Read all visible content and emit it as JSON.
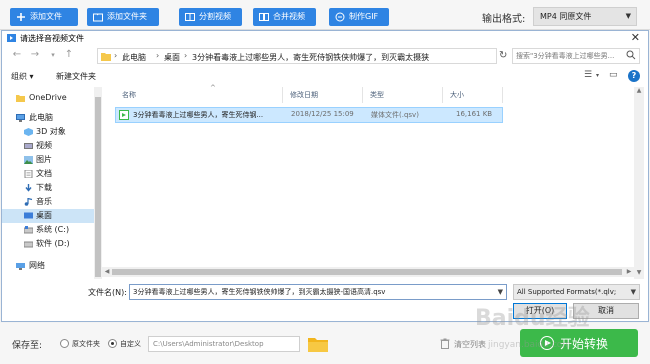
{
  "toolbar": {
    "add_file": "添加文件",
    "add_folder": "添加文件夹",
    "split_video": "分割视频",
    "merge_video": "合并视频",
    "make_gif": "制作GIF",
    "output_format_label": "输出格式:",
    "output_format_value": "MP4  同原文件",
    "accent": "#2f84e3"
  },
  "dialog": {
    "title": "请选择音视频文件",
    "breadcrumb": [
      "此电脑",
      "桌面",
      "3分钟看毒液上过哪些男人，寄生死侍钢铁侠帅爆了，到灭霸太摄狭"
    ],
    "search_placeholder": "搜索\"3分钟看毒液上过哪些男...",
    "organize": "组织 ▾",
    "new_folder": "新建文件夹",
    "nav": {
      "onedrive": "OneDrive",
      "this_pc": "此电脑",
      "objects3d": "3D 对象",
      "videos": "视频",
      "pictures": "图片",
      "documents": "文档",
      "downloads": "下载",
      "music": "音乐",
      "desktop": "桌面",
      "system_c": "系统 (C:)",
      "software_d": "软件 (D:)",
      "network": "网络"
    },
    "columns": {
      "name": "名称",
      "modified": "修改日期",
      "type": "类型",
      "size": "大小"
    },
    "file": {
      "name": "3分钟看毒液上过哪些男人，寄生死侍钢...",
      "modified": "2018/12/25 15:09",
      "type": "媒体文件(.qsv)",
      "size": "16,161 KB"
    },
    "filename_label": "文件名(N):",
    "filename_value": "3分钟看毒液上过哪些男人，寄生死侍钢铁侠帅爆了，到灭霸太摄狭-国语高清.qsv",
    "filetype_value": "All Supported Formats(*.qlv;",
    "open_button": "打开(O)",
    "cancel_button": "取消"
  },
  "bottom": {
    "save_to": "保存至:",
    "option_source": "原文件夹",
    "option_custom": "自定义",
    "path": "C:\\Users\\Administrator\\Desktop",
    "clear_list": "清空列表",
    "start": "开始转换",
    "start_color": "#3cb94a",
    "watermark": "Baidu经验",
    "watermark_sub": "jingyan.baidu.com"
  }
}
